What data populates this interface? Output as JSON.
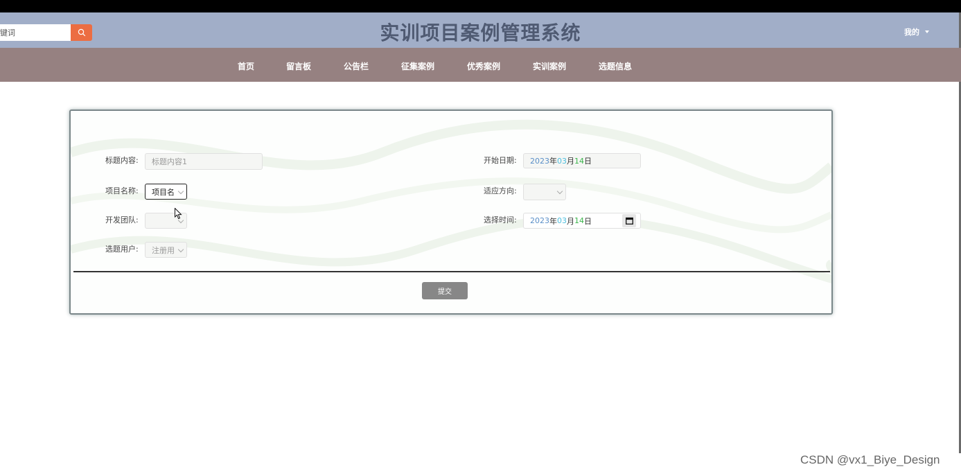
{
  "header": {
    "title": "实训项目案例管理系统",
    "search": {
      "value": "键词",
      "placeholder": "键词",
      "icon": "search-icon",
      "button_color": "#ec6d42"
    },
    "user_menu_label": "我的",
    "background": "#a1aec8"
  },
  "nav": {
    "background": "#968181",
    "items": [
      {
        "label": "首页"
      },
      {
        "label": "留言板"
      },
      {
        "label": "公告栏"
      },
      {
        "label": "征集案例"
      },
      {
        "label": "优秀案例"
      },
      {
        "label": "实训案例"
      },
      {
        "label": "选题信息"
      }
    ]
  },
  "form": {
    "title_content": {
      "label": "标题内容:",
      "value": "标题内容1"
    },
    "project_name": {
      "label": "项目名称:",
      "value": "项目名"
    },
    "dev_team": {
      "label": "开发团队:",
      "value": ""
    },
    "topic_user": {
      "label": "选题用户:",
      "value": "注册用"
    },
    "start_date": {
      "label": "开始日期:",
      "year": "2023",
      "y_unit": "年",
      "month": "03",
      "m_unit": "月",
      "day": "14",
      "d_unit": "日"
    },
    "direction": {
      "label": "适应方向:",
      "value": ""
    },
    "select_time": {
      "label": "选择时间:",
      "year": "2023",
      "y_unit": "年",
      "month": "03",
      "m_unit": "月",
      "day": "14",
      "d_unit": "日",
      "icon": "calendar-icon"
    },
    "submit_label": "提交"
  },
  "watermark": "CSDN @vx1_Biye_Design"
}
